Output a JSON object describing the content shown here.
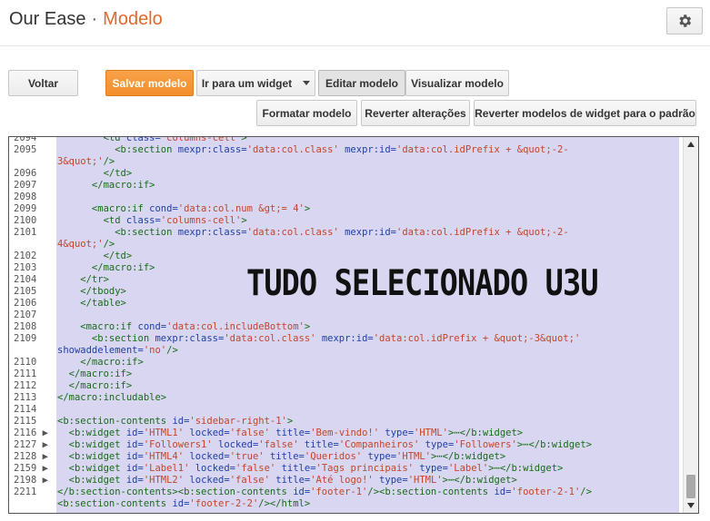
{
  "header": {
    "blog_name": "Our Ease",
    "separator": "·",
    "page_title": "Modelo",
    "settings_icon": "gear-icon"
  },
  "toolbar": {
    "back": "Voltar",
    "save_template": "Salvar modelo",
    "jump_to_widget": "Ir para um widget",
    "edit_template": "Editar modelo",
    "preview_template": "Visualizar modelo",
    "format_template": "Formatar modelo",
    "revert_changes": "Reverter alterações",
    "revert_widgets": "Reverter modelos de widget para o padrão"
  },
  "overlay_text": "TUDO SELECIONADO U3U",
  "editor": {
    "line_numbers": [
      "2094",
      "2095",
      "",
      "2096",
      "2097",
      "2098",
      "2099",
      "2100",
      "2101",
      "",
      "2102",
      "2103",
      "2104",
      "2105",
      "2106",
      "2107",
      "2108",
      "2109",
      "",
      "2110",
      "2111",
      "2112",
      "2113",
      "2114",
      "2115",
      "2116 ▶",
      "2127 ▶",
      "2128 ▶",
      "2159 ▶",
      "2198 ▶",
      "2211",
      ""
    ],
    "lines": [
      [
        [
          "t",
          "        <td "
        ],
        [
          "a",
          "class="
        ],
        [
          "v",
          "'columns-cell'"
        ],
        [
          "t",
          ">"
        ]
      ],
      [
        [
          "t",
          "          <b:section "
        ],
        [
          "a",
          "mexpr:class="
        ],
        [
          "v",
          "'data:col.class'"
        ],
        [
          "t",
          " "
        ],
        [
          "a",
          "mexpr:id="
        ],
        [
          "v",
          "'data:col.idPrefix + &quot;-2-"
        ]
      ],
      [
        [
          "v",
          "3&quot;'"
        ],
        [
          "t",
          "/>"
        ]
      ],
      [
        [
          "t",
          "        </td>"
        ]
      ],
      [
        [
          "t",
          "      </macro:if>"
        ]
      ],
      [
        [
          "t",
          ""
        ]
      ],
      [
        [
          "t",
          "      <macro:if "
        ],
        [
          "a",
          "cond="
        ],
        [
          "v",
          "'data:col.num &gt;= 4'"
        ],
        [
          "t",
          ">"
        ]
      ],
      [
        [
          "t",
          "        <td "
        ],
        [
          "a",
          "class="
        ],
        [
          "v",
          "'columns-cell'"
        ],
        [
          "t",
          ">"
        ]
      ],
      [
        [
          "t",
          "          <b:section "
        ],
        [
          "a",
          "mexpr:class="
        ],
        [
          "v",
          "'data:col.class'"
        ],
        [
          "t",
          " "
        ],
        [
          "a",
          "mexpr:id="
        ],
        [
          "v",
          "'data:col.idPrefix + &quot;-2-"
        ]
      ],
      [
        [
          "v",
          "4&quot;'"
        ],
        [
          "t",
          "/>"
        ]
      ],
      [
        [
          "t",
          "        </td>"
        ]
      ],
      [
        [
          "t",
          "      </macro:if>"
        ]
      ],
      [
        [
          "t",
          "    </tr>"
        ]
      ],
      [
        [
          "t",
          "    </tbody>"
        ]
      ],
      [
        [
          "t",
          "    </table>"
        ]
      ],
      [
        [
          "t",
          ""
        ]
      ],
      [
        [
          "t",
          "    <macro:if "
        ],
        [
          "a",
          "cond="
        ],
        [
          "v",
          "'data:col.includeBottom'"
        ],
        [
          "t",
          ">"
        ]
      ],
      [
        [
          "t",
          "      <b:section "
        ],
        [
          "a",
          "mexpr:class="
        ],
        [
          "v",
          "'data:col.class'"
        ],
        [
          "t",
          " "
        ],
        [
          "a",
          "mexpr:id="
        ],
        [
          "v",
          "'data:col.idPrefix + &quot;-3&quot;'"
        ]
      ],
      [
        [
          "a",
          "showaddelement="
        ],
        [
          "v",
          "'no'"
        ],
        [
          "t",
          "/>"
        ]
      ],
      [
        [
          "t",
          "    </macro:if>"
        ]
      ],
      [
        [
          "t",
          "  </macro:if>"
        ]
      ],
      [
        [
          "t",
          "  </macro:if>"
        ]
      ],
      [
        [
          "t",
          "</macro:includable>"
        ]
      ],
      [
        [
          "t",
          ""
        ]
      ],
      [
        [
          "t",
          "<b:section-contents "
        ],
        [
          "a",
          "id="
        ],
        [
          "v",
          "'sidebar-right-1'"
        ],
        [
          "t",
          ">"
        ]
      ],
      [
        [
          "t",
          "  <b:widget "
        ],
        [
          "a",
          "id="
        ],
        [
          "v",
          "'HTML1'"
        ],
        [
          "t",
          " "
        ],
        [
          "a",
          "locked="
        ],
        [
          "v",
          "'false'"
        ],
        [
          "t",
          " "
        ],
        [
          "a",
          "title="
        ],
        [
          "v",
          "'Bem-vindo!'"
        ],
        [
          "t",
          " "
        ],
        [
          "a",
          "type="
        ],
        [
          "v",
          "'HTML'"
        ],
        [
          "t",
          ">⋯</b:widget>"
        ]
      ],
      [
        [
          "t",
          "  <b:widget "
        ],
        [
          "a",
          "id="
        ],
        [
          "v",
          "'Followers1'"
        ],
        [
          "t",
          " "
        ],
        [
          "a",
          "locked="
        ],
        [
          "v",
          "'false'"
        ],
        [
          "t",
          " "
        ],
        [
          "a",
          "title="
        ],
        [
          "v",
          "'Companheiros'"
        ],
        [
          "t",
          " "
        ],
        [
          "a",
          "type="
        ],
        [
          "v",
          "'Followers'"
        ],
        [
          "t",
          ">⋯</b:widget>"
        ]
      ],
      [
        [
          "t",
          "  <b:widget "
        ],
        [
          "a",
          "id="
        ],
        [
          "v",
          "'HTML4'"
        ],
        [
          "t",
          " "
        ],
        [
          "a",
          "locked="
        ],
        [
          "v",
          "'true'"
        ],
        [
          "t",
          " "
        ],
        [
          "a",
          "title="
        ],
        [
          "v",
          "'Queridos'"
        ],
        [
          "t",
          " "
        ],
        [
          "a",
          "type="
        ],
        [
          "v",
          "'HTML'"
        ],
        [
          "t",
          ">⋯</b:widget>"
        ]
      ],
      [
        [
          "t",
          "  <b:widget "
        ],
        [
          "a",
          "id="
        ],
        [
          "v",
          "'Label1'"
        ],
        [
          "t",
          " "
        ],
        [
          "a",
          "locked="
        ],
        [
          "v",
          "'false'"
        ],
        [
          "t",
          " "
        ],
        [
          "a",
          "title="
        ],
        [
          "v",
          "'Tags principais'"
        ],
        [
          "t",
          " "
        ],
        [
          "a",
          "type="
        ],
        [
          "v",
          "'Label'"
        ],
        [
          "t",
          ">⋯</b:widget>"
        ]
      ],
      [
        [
          "t",
          "  <b:widget "
        ],
        [
          "a",
          "id="
        ],
        [
          "v",
          "'HTML2'"
        ],
        [
          "t",
          " "
        ],
        [
          "a",
          "locked="
        ],
        [
          "v",
          "'false'"
        ],
        [
          "t",
          " "
        ],
        [
          "a",
          "title="
        ],
        [
          "v",
          "'Até logo!'"
        ],
        [
          "t",
          " "
        ],
        [
          "a",
          "type="
        ],
        [
          "v",
          "'HTML'"
        ],
        [
          "t",
          ">⋯</b:widget>"
        ]
      ],
      [
        [
          "t",
          "</b:section-contents><b:section-contents "
        ],
        [
          "a",
          "id="
        ],
        [
          "v",
          "'footer-1'"
        ],
        [
          "t",
          "/><b:section-contents "
        ],
        [
          "a",
          "id="
        ],
        [
          "v",
          "'footer-2-1'"
        ],
        [
          "t",
          "/>"
        ]
      ],
      [
        [
          "t",
          "<b:section-contents "
        ],
        [
          "a",
          "id="
        ],
        [
          "v",
          "'footer-2-2'"
        ],
        [
          "t",
          "/></html>"
        ]
      ]
    ]
  }
}
